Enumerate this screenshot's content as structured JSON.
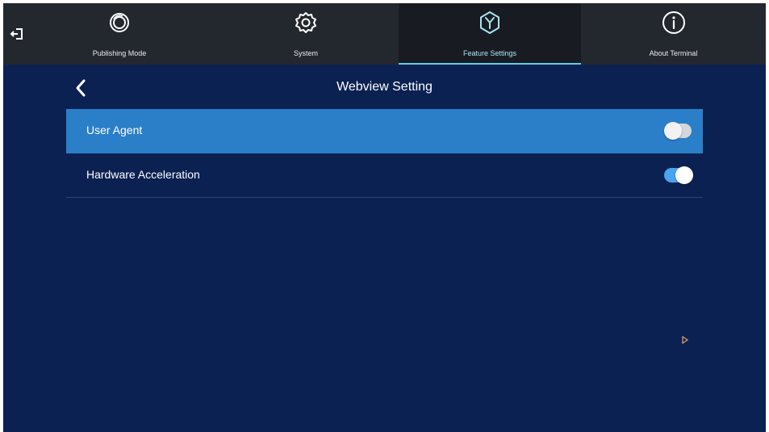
{
  "nav": {
    "tabs": [
      {
        "label": "Publishing Mode",
        "icon": "publishing-mode-icon",
        "active": false
      },
      {
        "label": "System",
        "icon": "gear-icon",
        "active": false
      },
      {
        "label": "Feature Settings",
        "icon": "feature-settings-icon",
        "active": true
      },
      {
        "label": "About Terminal",
        "icon": "info-icon",
        "active": false
      }
    ]
  },
  "page": {
    "title": "Webview Setting"
  },
  "settings": {
    "items": [
      {
        "label": "User Agent",
        "toggle": "off",
        "selected": true
      },
      {
        "label": "Hardware Acceleration",
        "toggle": "on",
        "selected": false
      }
    ]
  },
  "colors": {
    "background": "#0b2152",
    "topbar": "#23272e",
    "active_tab": "#181c22",
    "accent": "#63cde6",
    "selected_row": "#2b7fc8",
    "toggle_on": "#4aa3ee"
  }
}
